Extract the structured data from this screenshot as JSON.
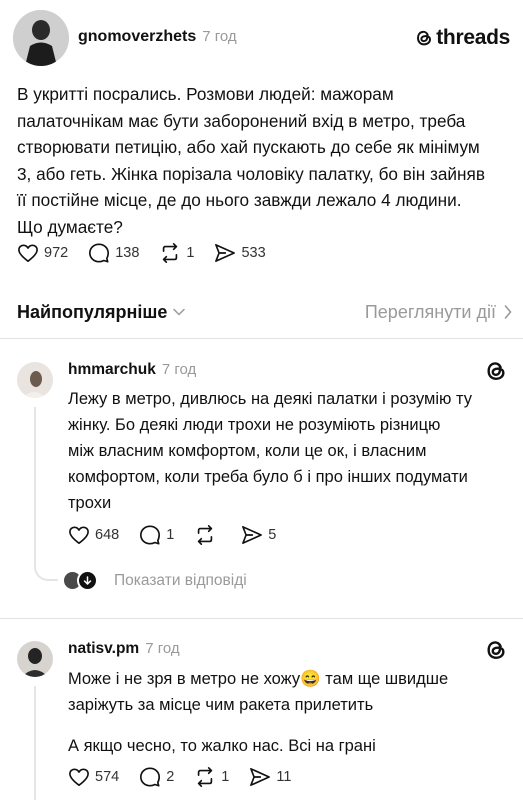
{
  "post": {
    "author": "gnomoverzhets",
    "time": "7 год",
    "brand": "threads",
    "text_lines": [
      "В укритті посрались. Розмови людей: мажорам",
      "палаточнікам має бути заборонений вхід в метро, треба",
      "створювати петицію, або хай пускають до себе як мінімум",
      "3, або геть. Жінка порізала чоловіку палатку, бо він зайняв",
      "її постійне місце, де до нього завжди лежало 4 людини.",
      "Що думаєте?"
    ],
    "likes": "972",
    "comments": "138",
    "reposts": "1",
    "shares": "533"
  },
  "sort": {
    "label": "Найпопулярніше",
    "activity_link": "Переглянути дії"
  },
  "replies": [
    {
      "author": "hmmarchuk",
      "time": "7 год",
      "text_lines": [
        "Лежу в метро, дивлюсь на деякі палатки і розумію ту",
        "жінку. Бо деякі люди трохи не розуміють різницю",
        "між власним комфортом, коли це ок, і власним",
        "комфортом, коли треба було б і про інших подумати",
        "трохи"
      ],
      "likes": "648",
      "comments": "1",
      "reposts": "",
      "shares": "5",
      "show_replies": "Показати відповіді"
    },
    {
      "author": "natisv.pm",
      "time": "7 год",
      "text_lines": [
        "Може і не зря в метро не хожу😄  там ще швидше",
        "заріжуть за місце чим ракета прилетить"
      ],
      "text_paragraph2": "А якщо чесно, то жалко нас. Всі на грані",
      "likes": "574",
      "comments": "2",
      "reposts": "1",
      "shares": "11"
    }
  ],
  "icons": {
    "like": "heart-icon",
    "comment": "speech-bubble-icon",
    "repost": "repost-icon",
    "share": "send-icon",
    "brand": "threads-logo-icon",
    "chevron_down": "chevron-down-icon",
    "chevron_right": "chevron-right-icon"
  }
}
